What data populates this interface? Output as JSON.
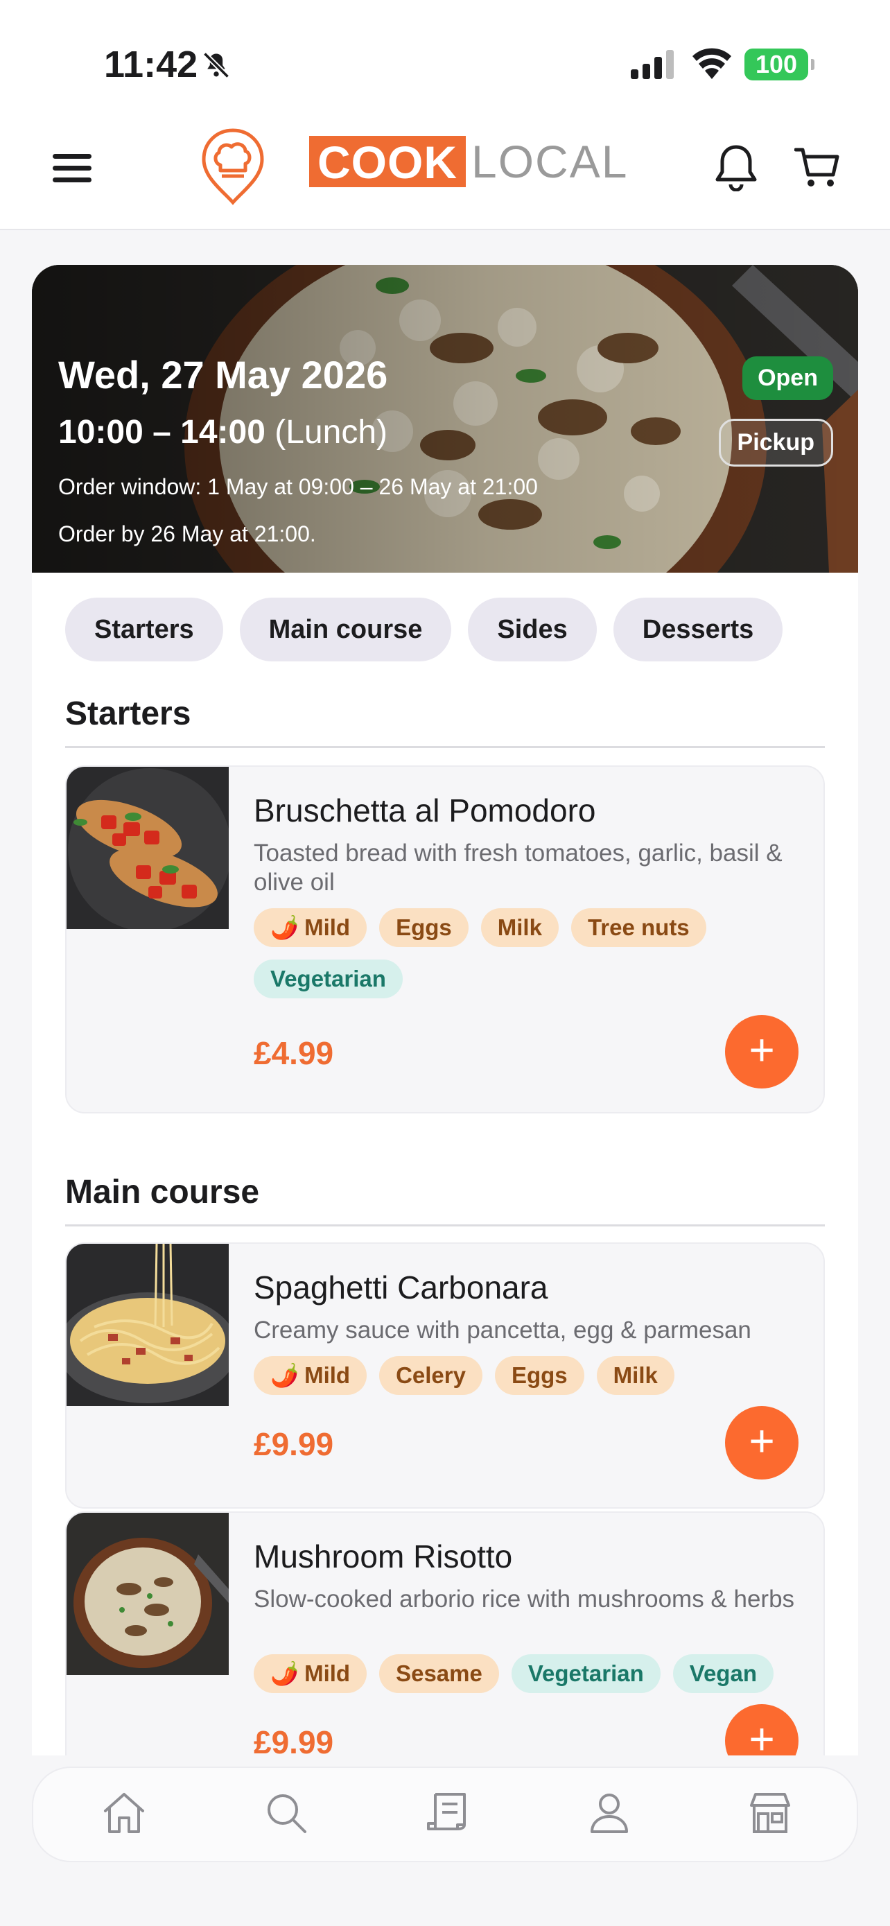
{
  "status_bar": {
    "time": "11:42",
    "battery": "100"
  },
  "header": {
    "brand_cook": "COOK",
    "brand_local": "LOCAL"
  },
  "hero": {
    "date": "Wed, 27 May 2026",
    "time_range": "10:00 – 14:00",
    "meal": "(Lunch)",
    "order_window": "Order window: 1 May at 09:00 – 26 May at 21:00",
    "order_by": "Order by 26 May at 21:00.",
    "status_badge": "Open",
    "fulfilment_badge": "Pickup"
  },
  "categories": [
    "Starters",
    "Main course",
    "Sides",
    "Desserts"
  ],
  "sections": [
    {
      "title": "Starters",
      "items": [
        {
          "name": "Bruschetta al Pomodoro",
          "description": "Toasted bread with fresh tomatoes, garlic, basil & olive oil",
          "spice": "Mild",
          "allergens": [
            "Eggs",
            "Milk",
            "Tree nuts"
          ],
          "diets": [
            "Vegetarian"
          ],
          "price": "£4.99"
        }
      ]
    },
    {
      "title": "Main course",
      "items": [
        {
          "name": "Spaghetti Carbonara",
          "description": "Creamy sauce with pancetta, egg & parmesan",
          "spice": "Mild",
          "allergens": [
            "Celery",
            "Eggs",
            "Milk"
          ],
          "diets": [],
          "price": "£9.99"
        },
        {
          "name": "Mushroom Risotto",
          "description": "Slow-cooked arborio rice with mushrooms & herbs",
          "spice": "Mild",
          "allergens": [
            "Sesame"
          ],
          "diets": [
            "Vegetarian",
            "Vegan"
          ],
          "price": "£9.99"
        }
      ]
    }
  ],
  "add_label": "+",
  "tab_bar": [
    "home-icon",
    "search-icon",
    "receipt-icon",
    "profile-icon",
    "store-icon"
  ],
  "colors": {
    "accent": "#ef6c32",
    "open": "#1e8e3e",
    "allergen_bg": "#fbe0c2",
    "diet_bg": "#d6f0ec"
  }
}
